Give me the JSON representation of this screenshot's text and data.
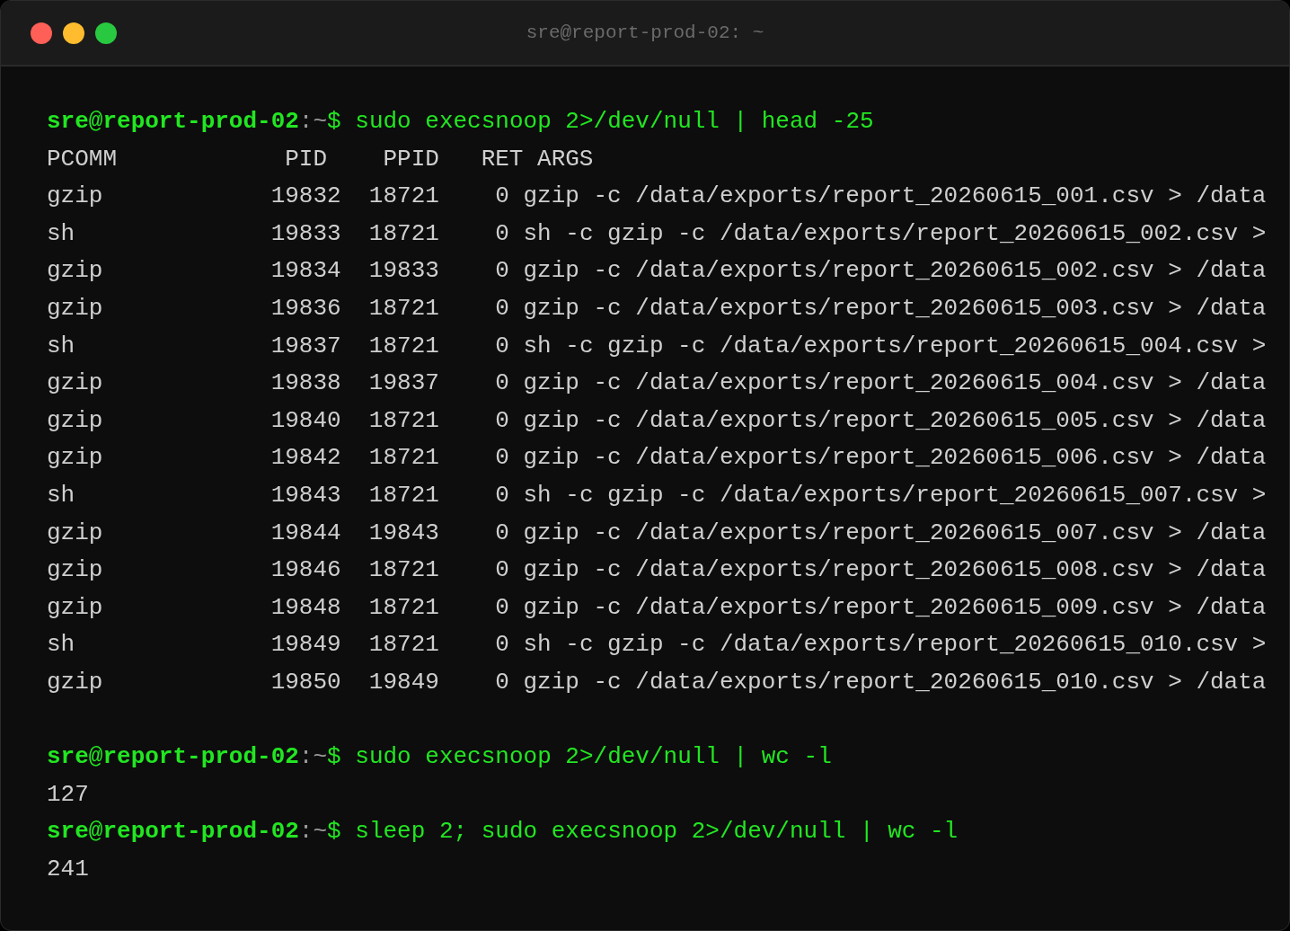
{
  "window": {
    "title": "sre@report-prod-02: ~",
    "controls": [
      {
        "kind": "close"
      },
      {
        "kind": "minimize"
      },
      {
        "kind": "zoom"
      }
    ]
  },
  "blocks": [
    {
      "kind": "table",
      "prompt": {
        "user": "sre",
        "at": "@",
        "host": "report-prod-02",
        "colon": ":",
        "path": "~",
        "sigil": "$"
      },
      "command": "sudo execsnoop 2>/dev/null | head -25",
      "table": {
        "columns": [
          "PCOMM",
          "PID",
          "PPID",
          "RET",
          "ARGS"
        ],
        "rows": [
          {
            "pcomm": "gzip",
            "pid": "19832",
            "ppid": "18721",
            "ret": "0",
            "args": "gzip -c /data/exports/report_20260615_001.csv > /data"
          },
          {
            "pcomm": "sh",
            "pid": "19833",
            "ppid": "18721",
            "ret": "0",
            "args": "sh -c gzip -c /data/exports/report_20260615_002.csv >"
          },
          {
            "pcomm": "gzip",
            "pid": "19834",
            "ppid": "19833",
            "ret": "0",
            "args": "gzip -c /data/exports/report_20260615_002.csv > /data"
          },
          {
            "pcomm": "gzip",
            "pid": "19836",
            "ppid": "18721",
            "ret": "0",
            "args": "gzip -c /data/exports/report_20260615_003.csv > /data"
          },
          {
            "pcomm": "sh",
            "pid": "19837",
            "ppid": "18721",
            "ret": "0",
            "args": "sh -c gzip -c /data/exports/report_20260615_004.csv >"
          },
          {
            "pcomm": "gzip",
            "pid": "19838",
            "ppid": "19837",
            "ret": "0",
            "args": "gzip -c /data/exports/report_20260615_004.csv > /data"
          },
          {
            "pcomm": "gzip",
            "pid": "19840",
            "ppid": "18721",
            "ret": "0",
            "args": "gzip -c /data/exports/report_20260615_005.csv > /data"
          },
          {
            "pcomm": "gzip",
            "pid": "19842",
            "ppid": "18721",
            "ret": "0",
            "args": "gzip -c /data/exports/report_20260615_006.csv > /data"
          },
          {
            "pcomm": "sh",
            "pid": "19843",
            "ppid": "18721",
            "ret": "0",
            "args": "sh -c gzip -c /data/exports/report_20260615_007.csv >"
          },
          {
            "pcomm": "gzip",
            "pid": "19844",
            "ppid": "19843",
            "ret": "0",
            "args": "gzip -c /data/exports/report_20260615_007.csv > /data"
          },
          {
            "pcomm": "gzip",
            "pid": "19846",
            "ppid": "18721",
            "ret": "0",
            "args": "gzip -c /data/exports/report_20260615_008.csv > /data"
          },
          {
            "pcomm": "gzip",
            "pid": "19848",
            "ppid": "18721",
            "ret": "0",
            "args": "gzip -c /data/exports/report_20260615_009.csv > /data"
          },
          {
            "pcomm": "sh",
            "pid": "19849",
            "ppid": "18721",
            "ret": "0",
            "args": "sh -c gzip -c /data/exports/report_20260615_010.csv >"
          },
          {
            "pcomm": "gzip",
            "pid": "19850",
            "ppid": "19849",
            "ret": "0",
            "args": "gzip -c /data/exports/report_20260615_010.csv > /data"
          }
        ]
      }
    },
    {
      "kind": "output",
      "prompt": {
        "user": "sre",
        "at": "@",
        "host": "report-prod-02",
        "colon": ":",
        "path": "~",
        "sigil": "$"
      },
      "command": "sudo execsnoop 2>/dev/null | wc -l",
      "output": "127"
    },
    {
      "kind": "output",
      "prompt": {
        "user": "sre",
        "at": "@",
        "host": "report-prod-02",
        "colon": ":",
        "path": "~",
        "sigil": "$"
      },
      "command": "sleep 2; sudo execsnoop 2>/dev/null | wc -l",
      "output": "241"
    }
  ]
}
